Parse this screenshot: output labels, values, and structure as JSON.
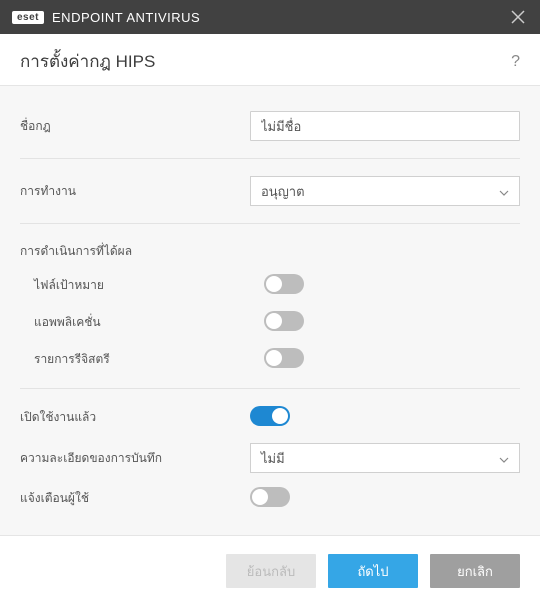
{
  "titlebar": {
    "brand": "eset",
    "product": "ENDPOINT ANTIVIRUS"
  },
  "page_title": "การตั้งค่ากฎ HIPS",
  "fields": {
    "rule_name_label": "ชื่อกฎ",
    "rule_name_value": "ไม่มีชื่อ",
    "action_label": "การทำงาน",
    "action_value": "อนุญาต",
    "affecting_section": "การดำเนินการที่ได้ผล",
    "target_files_label": "ไฟล์เป้าหมาย",
    "applications_label": "แอพพลิเคชั่น",
    "registry_label": "รายการรีจิสตรี",
    "enabled_label": "เปิดใช้งานแล้ว",
    "log_detail_label": "ความละเอียดของการบันทึก",
    "log_detail_value": "ไม่มี",
    "notify_user_label": "แจ้งเตือนผู้ใช้"
  },
  "toggles": {
    "target_files": false,
    "applications": false,
    "registry": false,
    "enabled": true,
    "notify_user": false
  },
  "buttons": {
    "back": "ย้อนกลับ",
    "next": "ถัดไป",
    "cancel": "ยกเลิก"
  }
}
